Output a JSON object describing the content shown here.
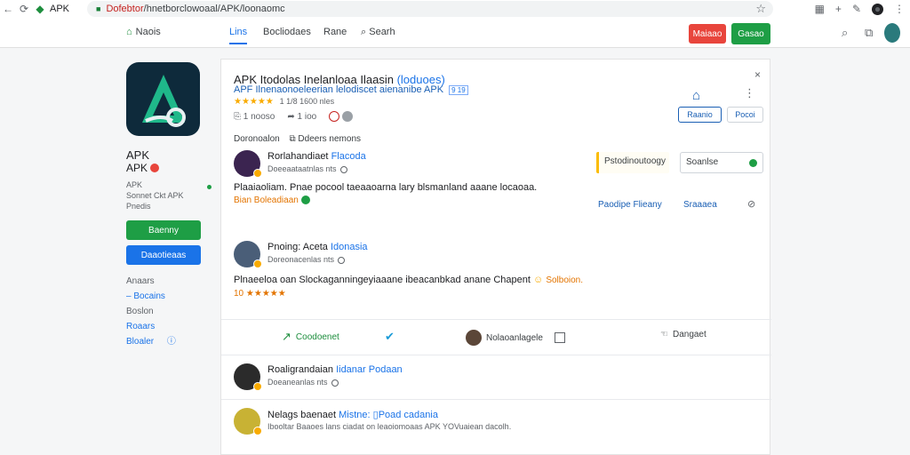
{
  "browser": {
    "tab_title": "APK",
    "url_host": "Dofebtor",
    "url_path": "/hnetborclowoaal/APK/loonaomc",
    "avatar_letter": "●"
  },
  "nav": {
    "home": "Naois",
    "tabs": [
      "Lins",
      "Bocliodaes",
      "Rane"
    ],
    "search": "Searh",
    "btn_red": "Maiaao",
    "btn_green": "Gasao"
  },
  "app": {
    "name_line1": "APK",
    "name_line2": "APK",
    "meta1": "APK",
    "meta2": "Sonnet Ckt APK",
    "meta3": "Pnedis",
    "install_label": "Baenny",
    "download_label": "Daaotieaas",
    "links": [
      "Anaars",
      "Bocains",
      "Boslon",
      "Roaars",
      "Bloaler"
    ]
  },
  "header": {
    "title": "APK Itodolas Inelanloaa Ilaasin",
    "title_tag": "(loduoes)",
    "subtitle": "APF Ilnenaonoeleerian lelodiscet aienanibe APK",
    "subtitle_chip": "9 19",
    "stars": "★★★★★",
    "rating_text": "1 1/8 1600 nles",
    "stat1": "1 nooso",
    "stat2": "1 ioo",
    "btn1": "Raanio",
    "btn2": "Pocoi"
  },
  "section": {
    "label": "Doronoalon",
    "sub": "Ddeers nemons"
  },
  "reviews": [
    {
      "name": "Rorlahandiaet",
      "loc": "Flacoda",
      "time": "Doeeaataatnlas nts",
      "text": "Plaaiaoliam. Pnae pocool taeaaoarna lary blsmanland aaane locaoaa.",
      "extra": "Bian Boleadiaan"
    },
    {
      "name": "Pnoing: Aceta",
      "loc": "Idonasia",
      "time": "Doreonacenlas nts",
      "text": "Plnaeeloa oan Slockaganningeyiaaane ibeacanbkad anane Chapent",
      "extra": "Solboion.",
      "stars": "10 ★★★★★"
    },
    {
      "name": "Roaligrandaian",
      "loc": "Iidanar Podaan",
      "time": "Doeaneanlas nts"
    },
    {
      "name": "Nelags baenaet",
      "loc": "Mistne: ▯Poad cadania",
      "time": "Ibooltar Baaoes lans ciadat on leaoiomoaas APK YOVuaiean dacolh."
    }
  ],
  "side": {
    "box1": "Pstodinoutoogy",
    "box2": "Soanlse",
    "link1": "Paodipe Flieany",
    "link2": "Sraaaea"
  },
  "actions": {
    "a1": "Coodoenet",
    "a3": "Nolaoanlagele",
    "a4": "Dangaet"
  }
}
